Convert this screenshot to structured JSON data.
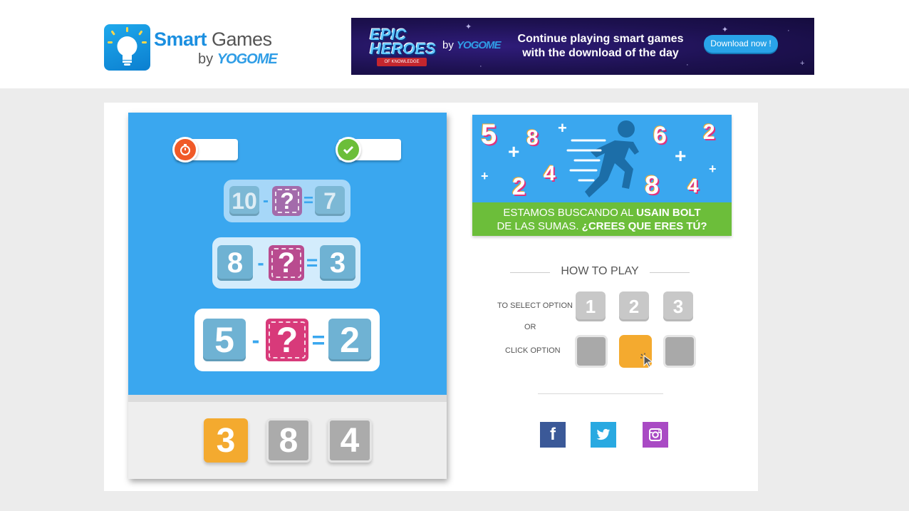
{
  "header": {
    "logo": {
      "title_bold": "Smart",
      "title_light": " Games",
      "by": "by",
      "brand": "YOGOME"
    },
    "banner": {
      "game_title_line1": "EPIC",
      "game_title_line2": "HEROES",
      "game_subtitle": "OF KNOWLEDGE",
      "by": "by",
      "brand": "YOGOME",
      "line1": "Continue playing smart games",
      "line2": "with the download of the day",
      "download_label": "Download now !"
    }
  },
  "game": {
    "timer": {
      "icon": "stopwatch-icon",
      "value": ""
    },
    "score": {
      "icon": "check-icon",
      "value": ""
    },
    "equations": [
      {
        "left": "10",
        "operator": "-",
        "unknown": "?",
        "equals": "=",
        "result": "7"
      },
      {
        "left": "8",
        "operator": "-",
        "unknown": "?",
        "equals": "=",
        "result": "3"
      },
      {
        "left": "5",
        "operator": "-",
        "unknown": "?",
        "equals": "=",
        "result": "2"
      }
    ],
    "options": [
      {
        "label": "3",
        "selected": true
      },
      {
        "label": "8",
        "selected": false
      },
      {
        "label": "4",
        "selected": false
      }
    ],
    "colors": {
      "sky": "#3aa7ef",
      "selected": "#f4aa2f",
      "unselected": "#ababab"
    }
  },
  "promo": {
    "numbers": [
      "5",
      "8",
      "2",
      "4",
      "6",
      "2",
      "8",
      "4"
    ],
    "plus": "+",
    "line1_prefix": "ESTAMOS BUSCANDO AL ",
    "line1_bold": "USAIN BOLT",
    "line2_prefix": "DE LAS SUMAS. ",
    "line2_bold": "¿CREES QUE ERES TÚ?"
  },
  "how_to_play": {
    "title": "HOW TO PLAY",
    "select_label": "TO SELECT OPTION",
    "or_label": "OR",
    "click_label": "CLICK OPTION",
    "keys": [
      "1",
      "2",
      "3"
    ]
  },
  "social": {
    "facebook": "f",
    "twitter_icon": "twitter-icon",
    "instagram_icon": "instagram-icon"
  }
}
